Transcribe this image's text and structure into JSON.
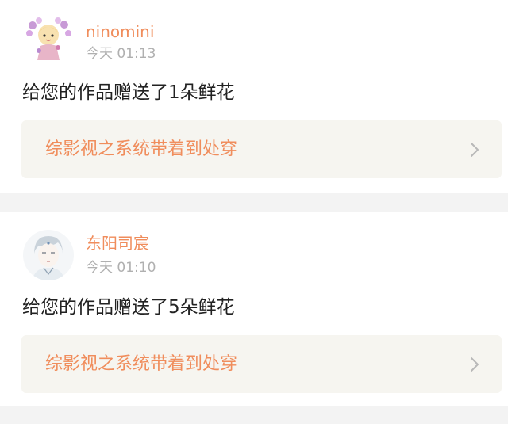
{
  "notifications": [
    {
      "username": "ninomini",
      "time": "今天 01:13",
      "message": "给您的作品赠送了1朵鲜花",
      "work_title": "综影视之系统带着到处穿",
      "avatar_icon": "cartoon-girl-avatar"
    },
    {
      "username": "东阳司宸",
      "time": "今天 01:10",
      "message": "给您的作品赠送了5朵鲜花",
      "work_title": "综影视之系统带着到处穿",
      "avatar_icon": "sketch-portrait-avatar"
    }
  ],
  "colors": {
    "accent": "#f08d5c",
    "timestamp": "#b0b0b0",
    "text": "#222222",
    "link_background": "#f6f5f0",
    "page_background": "#f3f3f3"
  }
}
